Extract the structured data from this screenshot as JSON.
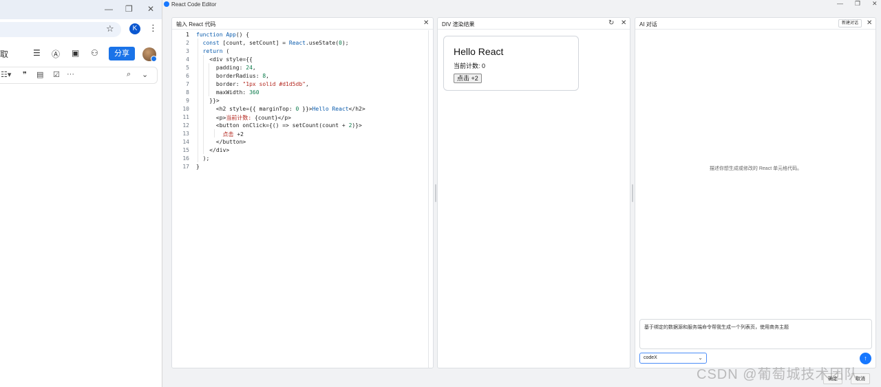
{
  "browser": {
    "window_controls": {
      "minimize": "—",
      "restore": "❐",
      "close": "✕"
    },
    "star": "☆",
    "profile_initial": "K",
    "toolbar_partial_label": "取",
    "share_label": "分享",
    "format_overflow": "···"
  },
  "app": {
    "title": "React Code Editor",
    "window_controls": {
      "minimize": "—",
      "restore": "❐",
      "close": "✕"
    }
  },
  "code_panel": {
    "title": "输入 React 代码",
    "close": "✕",
    "line_numbers": [
      "1",
      "2",
      "3",
      "4",
      "5",
      "6",
      "7",
      "8",
      "9",
      "10",
      "11",
      "12",
      "13",
      "14",
      "15",
      "16",
      "17"
    ]
  },
  "preview_panel": {
    "title": "DIV 渲染结果",
    "refresh": "↻",
    "close": "✕",
    "heading": "Hello React",
    "count_text": "当前计数: 0",
    "button_label": "点击 +2"
  },
  "ai_panel": {
    "title": "AI 对话",
    "new_chat_label": "新建对话",
    "close": "✕",
    "empty_hint": "描述你想生成或修改的 React 单元格代码。",
    "input_value": "基于绑定的数据源和服务端命令帮我生成一个列表页，使用商务主题",
    "model_select": "codeX",
    "send": "↑"
  },
  "bottom": {
    "confirm_label": "确定",
    "cancel_label": "取消"
  },
  "watermark": "CSDN @葡萄城技术团队"
}
